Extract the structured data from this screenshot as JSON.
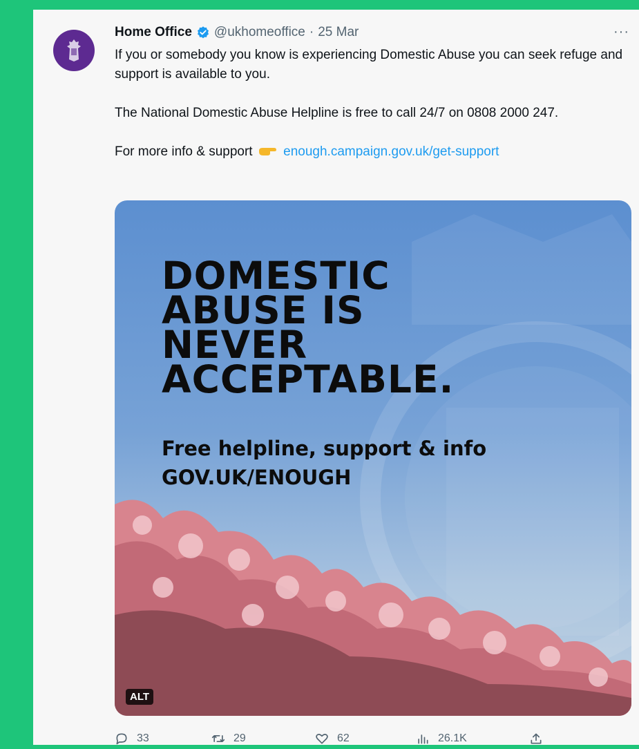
{
  "tweet": {
    "author_name": "Home Office",
    "handle": "@ukhomeoffice",
    "separator": "·",
    "date": "25 Mar",
    "paragraph_1": "If you or somebody you know is experiencing Domestic Abuse you can seek refuge and support is available to you.",
    "paragraph_2": "The National Domestic Abuse Helpline is free to call 24/7 on 0808 2000 247.",
    "paragraph_3_prefix": "For more info & support",
    "link_text": "enough.campaign.gov.uk/get-support",
    "more_label": "···"
  },
  "media": {
    "headline_lines": [
      "DOMESTIC",
      "ABUSE IS",
      "NEVER",
      "ACCEPTABLE."
    ],
    "subline_1": "Free helpline, support & info",
    "subline_2": "GOV.UK/ENOUGH",
    "alt_badge": "ALT"
  },
  "actions": {
    "replies": "33",
    "retweets": "29",
    "likes": "62",
    "views": "26.1K"
  },
  "icons": [
    "crest-icon",
    "verified-badge-icon",
    "pointing-hand-icon",
    "reply-icon",
    "retweet-icon",
    "like-icon",
    "views-icon",
    "share-icon"
  ],
  "colors": {
    "frame": "#1ec57a",
    "avatar": "#5d2a91",
    "link": "#1d9bf0",
    "verified": "#1d9bf0"
  }
}
